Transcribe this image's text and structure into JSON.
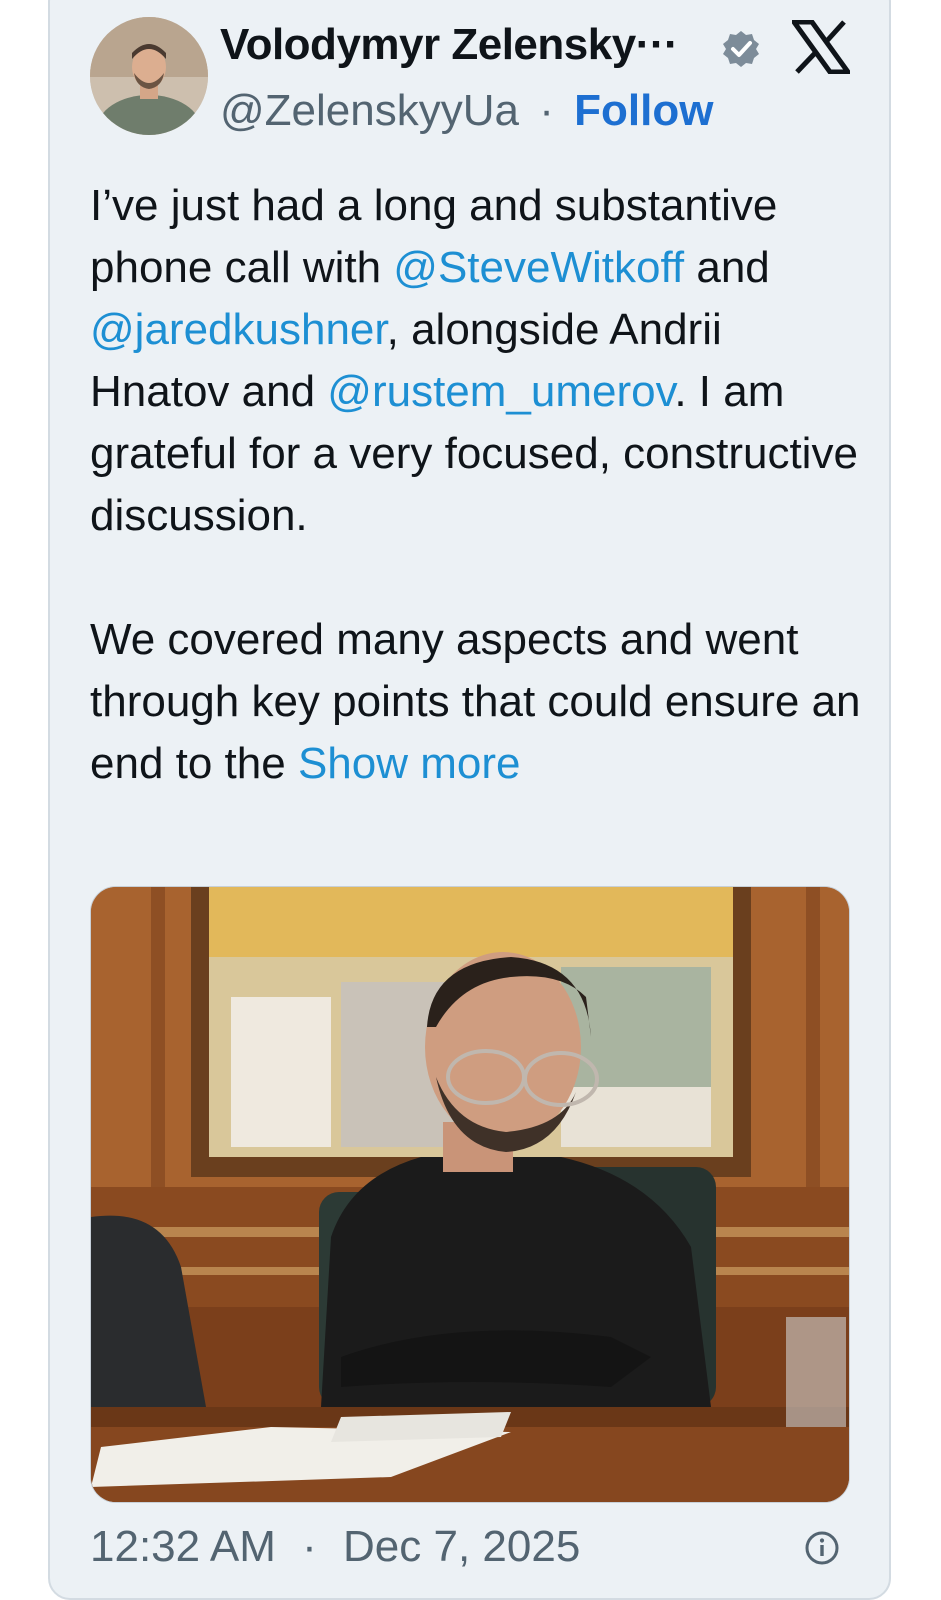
{
  "tweet": {
    "author_name": "Volodymyr Zelensky···",
    "handle": "@ZelenskyyUa",
    "separator": "·",
    "follow_label": "Follow",
    "paragraph1": [
      {
        "text": "I’ve just had a long and substantive phone call with ",
        "type": "text"
      },
      {
        "text": "@SteveWitkoff",
        "type": "mention"
      },
      {
        "text": " and ",
        "type": "text"
      },
      {
        "text": "@jaredkushner",
        "type": "mention"
      },
      {
        "text": ", alongside Andrii Hnatov and ",
        "type": "text"
      },
      {
        "text": "@rustem_umerov",
        "type": "mention"
      },
      {
        "text": ". I am grateful for a very focused, constructive discussion.",
        "type": "text"
      }
    ],
    "paragraph2": "We covered many aspects and went through key points that could ensure an end to the ",
    "show_more_label": "Show more",
    "time": "12:32 AM",
    "date": "Dec 7, 2025"
  },
  "icons": {
    "verified": "verified-badge-icon",
    "brand": "x-logo-icon",
    "info": "info-icon"
  },
  "colors": {
    "card_bg": "#ecf1f5",
    "link": "#1d8fd3",
    "follow": "#1d6fd1",
    "text": "#0f1419",
    "muted": "#536471"
  }
}
